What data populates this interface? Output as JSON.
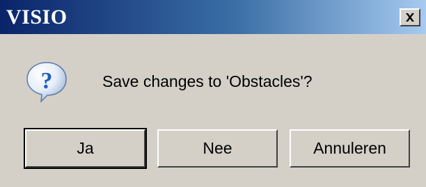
{
  "window": {
    "title": "VISIO"
  },
  "dialog": {
    "message": "Save changes to 'Obstacles'?",
    "icon": "question-icon",
    "buttons": {
      "yes_label": "Ja",
      "no_label": "Nee",
      "cancel_label": "Annuleren"
    }
  },
  "colors": {
    "titlebar_start": "#0a246a",
    "titlebar_end": "#a6caf0",
    "dialog_bg": "#d4d0c8",
    "icon_blue": "#1f5fbf"
  }
}
